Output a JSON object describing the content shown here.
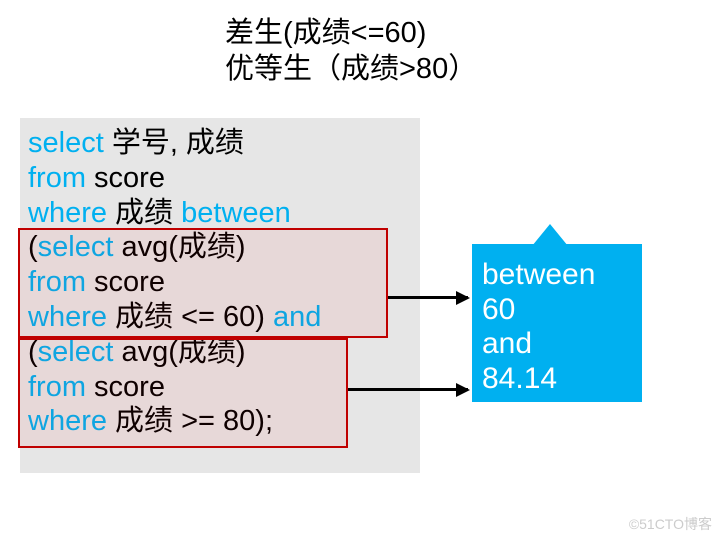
{
  "title": {
    "line1": "差生(成绩<=60)",
    "line2": "优等生（成绩>80）"
  },
  "sql": {
    "k_select": "select",
    "l1_rest": " 学号, 成绩",
    "k_from": "from",
    "l2_rest": " score",
    "k_where": "where",
    "l3_rest": " 成绩 ",
    "k_between": "between",
    "l4_open": "(",
    "l4_rest": " avg(成绩)",
    "l5_rest": " score",
    "l6_rest": " 成绩 <= 60) ",
    "k_and": "and",
    "l7_open": "(",
    "l7_rest": " avg(成绩)",
    "l8_rest": " score",
    "l9_rest": " 成绩 >= 80);"
  },
  "callout": {
    "l1": "between",
    "l2": "60",
    "l3": "and",
    "l4": "84.14"
  },
  "watermark": "©51CTO博客"
}
